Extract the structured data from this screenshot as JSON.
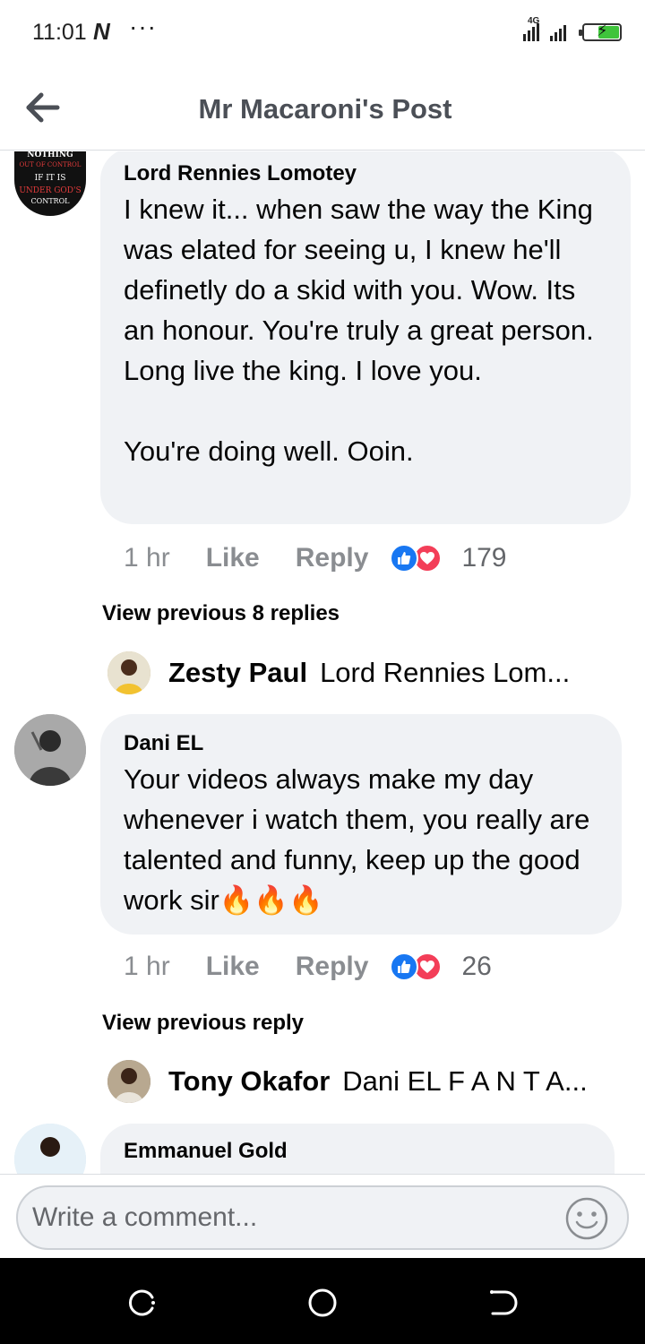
{
  "status_bar": {
    "time": "11:01",
    "notification_glyph": "N",
    "more_dots": "···",
    "network": "4G",
    "battery_level": 0.6,
    "battery_color": "#3fc43b"
  },
  "header": {
    "title": "Mr Macaroni's Post",
    "back_icon": "arrow-left-icon"
  },
  "comments": [
    {
      "author": "Lord Rennies Lomotey",
      "text": "I knew it... when saw the way the King was elated for seeing u, I knew he'll definetly do a skid with you. Wow. Its an honour. You're truly a great person. Long live the king. I love you.\n\nYou're doing well. Ooin.",
      "time": "1 hr",
      "like_label": "Like",
      "reply_label": "Reply",
      "reactions": [
        "like-icon",
        "love-icon"
      ],
      "reaction_count": "179",
      "view_previous": "View previous 8 replies",
      "reply_preview": {
        "name": "Zesty Paul",
        "snippet": "Lord Rennies Lom..."
      }
    },
    {
      "author": "Dani EL",
      "text": "Your videos always make my day whenever i watch them, you really are talented and funny, keep up the good work sir🔥🔥🔥",
      "time": "1 hr",
      "like_label": "Like",
      "reply_label": "Reply",
      "reactions": [
        "like-icon",
        "love-icon"
      ],
      "reaction_count": "26",
      "view_previous": "View previous reply",
      "reply_preview": {
        "name": "Tony Okafor",
        "snippet": "Dani EL F A N T A..."
      }
    },
    {
      "author": "Emmanuel Gold",
      "text": ""
    }
  ],
  "avatar_badge_lines": [
    "NOTHING",
    "OUT OF CONTROL",
    "IF IT IS",
    "UNDER GOD'S",
    "CONTROL"
  ],
  "composer": {
    "placeholder": "Write a comment...",
    "emoji_icon": "smiley-icon"
  },
  "nav_bar": {
    "buttons": [
      "recents-icon",
      "home-icon",
      "back-icon"
    ]
  },
  "colors": {
    "bubble": "#f0f2f5",
    "like_blue": "#1877f2",
    "love_red": "#f33e58",
    "secondary_text": "#65676b"
  }
}
